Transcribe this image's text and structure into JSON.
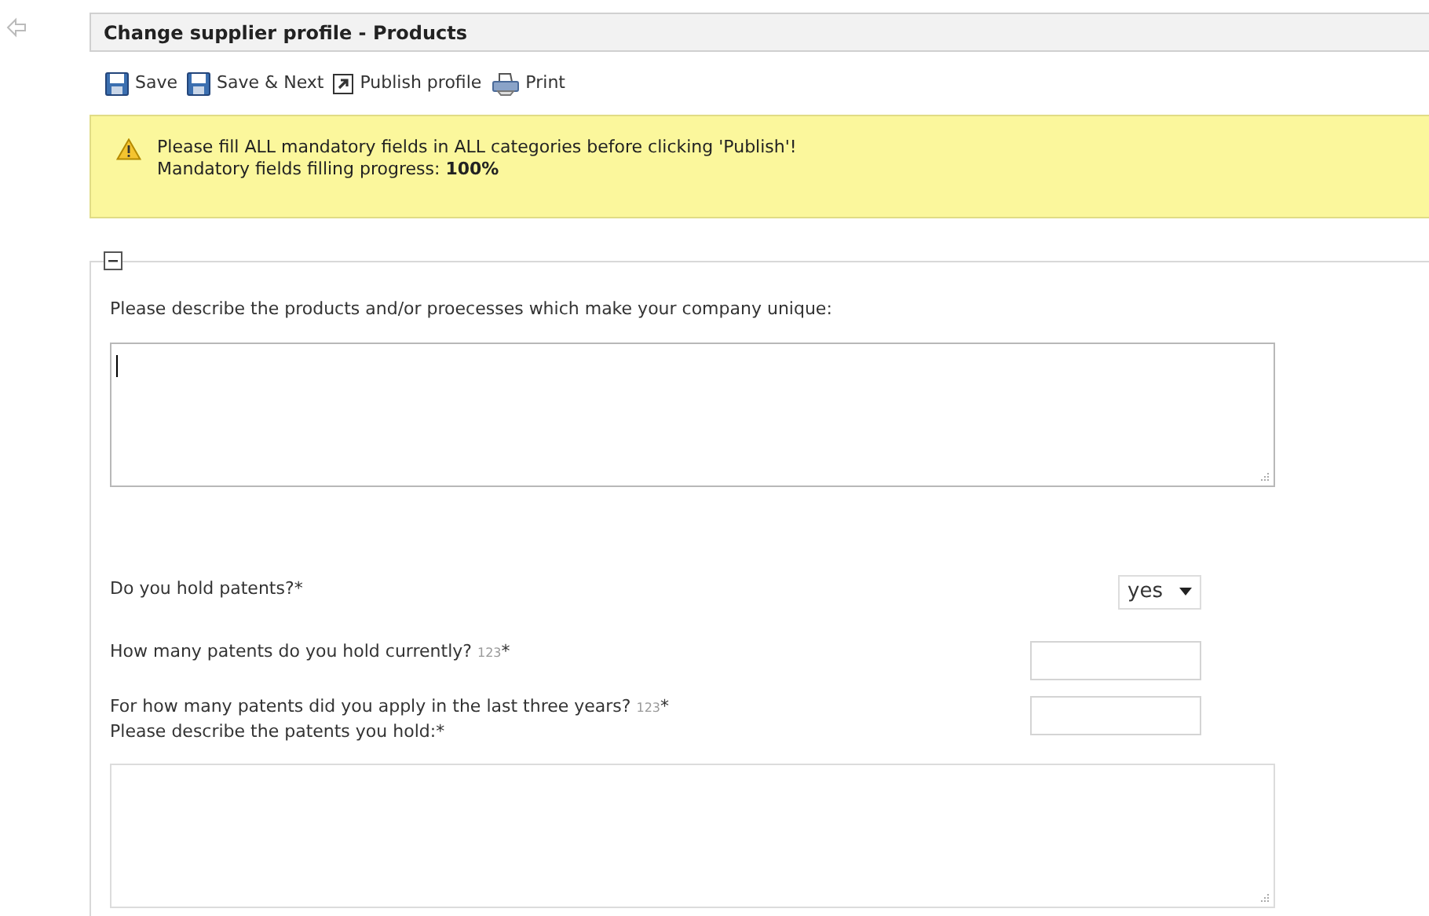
{
  "header": {
    "title": "Change supplier profile - Products"
  },
  "toolbar": [
    {
      "kind": "save",
      "label": "Save"
    },
    {
      "kind": "save",
      "label": "Save & Next"
    },
    {
      "kind": "publish",
      "label": "Publish profile"
    },
    {
      "kind": "print",
      "label": "Print"
    }
  ],
  "notice": {
    "line_1": "Please fill ALL mandatory fields in ALL categories before clicking 'Publish'!",
    "line_2": "Mandatory fields filling progress: **100%**"
  },
  "section": {
    "expanded": true,
    "fields": [
      {
        "kind": "textarea",
        "label": "Please describe the products and/or proecesses which make your company unique:",
        "focused": true
      },
      {
        "kind": "select",
        "label": "Do you hold patents?",
        "mark": "*",
        "value": "yes"
      },
      {
        "kind": "number",
        "label": "How many patents do you hold currently?",
        "hint": "123",
        "mark": "*"
      },
      {
        "kind": "number",
        "label": "For how many patents did you apply in the last three years?",
        "hint": "123",
        "mark": "*"
      },
      {
        "kind": "textarea",
        "label": "Please describe the patents you hold:",
        "mark": "*",
        "focused": false
      }
    ]
  }
}
